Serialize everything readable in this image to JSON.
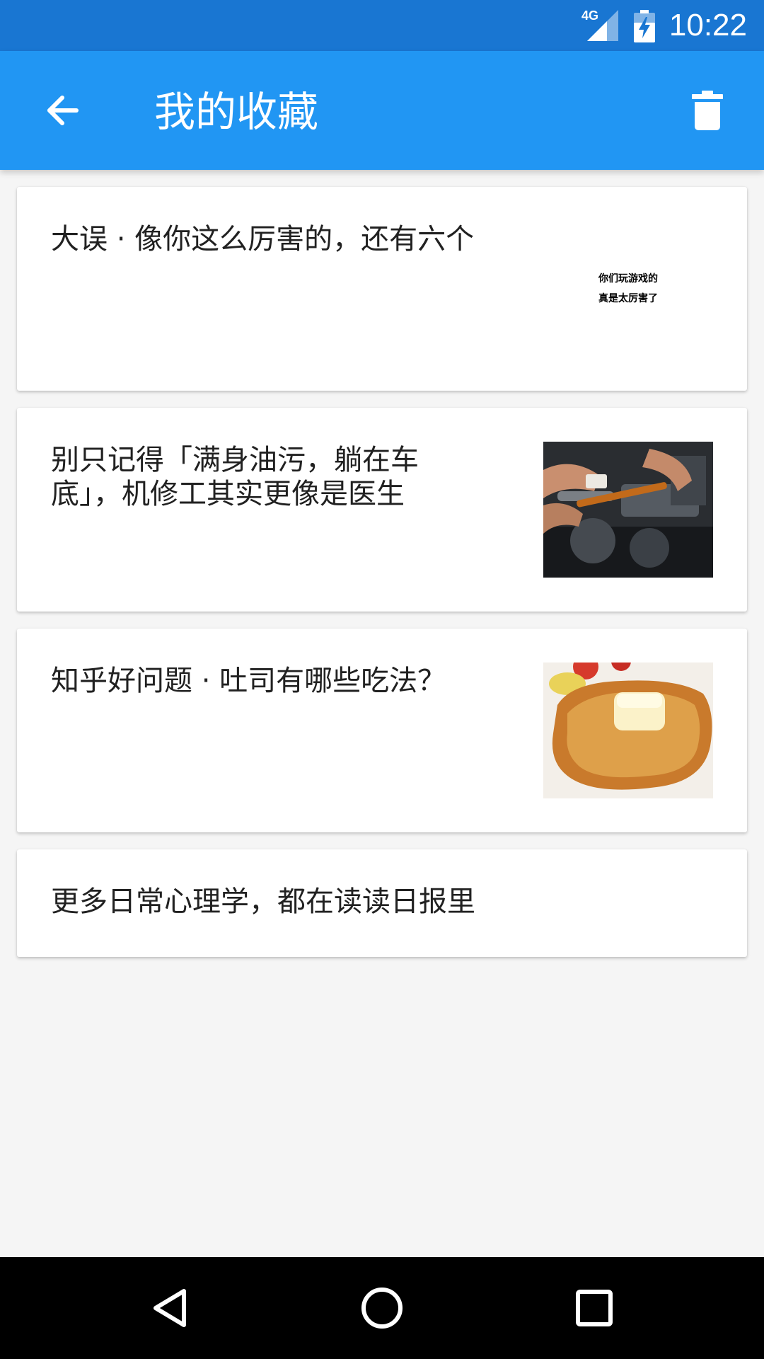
{
  "status_bar": {
    "network": "4G",
    "time": "10:22",
    "icons": [
      "signal-icon",
      "battery-charging-icon"
    ]
  },
  "app_bar": {
    "title": "我的收藏",
    "back_icon": "arrow-left-icon",
    "delete_icon": "trash-icon",
    "background_color": "#2196f3",
    "status_color": "#1976d2"
  },
  "favorites": [
    {
      "title": "大误 · 像你这么厉害的，还有六个",
      "thumbnail_text": [
        "你们玩游戏的",
        "真是太厉害了"
      ]
    },
    {
      "title": "别只记得「满身油污，躺在车底」，机修工其实更像是医生",
      "thumbnail": "mechanic-engine-photo"
    },
    {
      "title": "知乎好问题 · 吐司有哪些吃法？",
      "thumbnail": "french-toast-photo"
    },
    {
      "title": "更多日常心理学，都在读读日报里"
    }
  ],
  "nav_bar": {
    "icons": [
      "back-triangle-icon",
      "home-circle-icon",
      "recents-square-icon"
    ]
  }
}
